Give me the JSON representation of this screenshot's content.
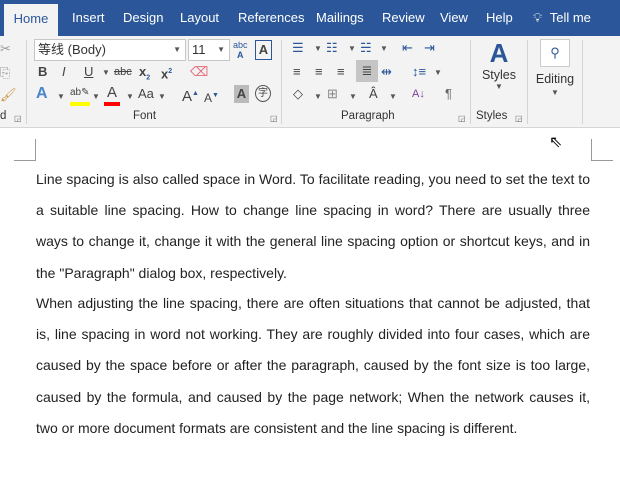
{
  "tabs": [
    "Home",
    "Insert",
    "Design",
    "Layout",
    "References",
    "Mailings",
    "Review",
    "View",
    "Help"
  ],
  "tell_me": "Tell me",
  "font": {
    "name": "等线 (Body)",
    "size": "11",
    "group_label": "Font"
  },
  "paragraph": {
    "group_label": "Paragraph"
  },
  "styles": {
    "button_label": "Styles",
    "group_label": "Styles"
  },
  "editing": {
    "button_label": "Editing"
  },
  "clipboard": {
    "group_label_fragment": "d"
  },
  "colors": {
    "accent": "#2b579a",
    "highlight": "#ffff00",
    "font_color": "#ff0000"
  },
  "document": {
    "paragraphs": [
      "Line spacing is also called space in Word. To facilitate reading, you need to set the text to a suitable line spacing. How to change line spacing in word? There are usually three ways to change it, change it with the general line spacing option or shortcut keys, and in the \"Paragraph\" dialog box, respectively.",
      "When adjusting the line spacing, there are often situations that cannot be adjusted, that is, line spacing in word not working. They are roughly divided into four cases, which are caused by the space before or after the paragraph, caused by the font size is too large, caused by the formula, and caused by the page network; When the network causes it, two or more document formats are consistent and the line spacing is different."
    ]
  }
}
